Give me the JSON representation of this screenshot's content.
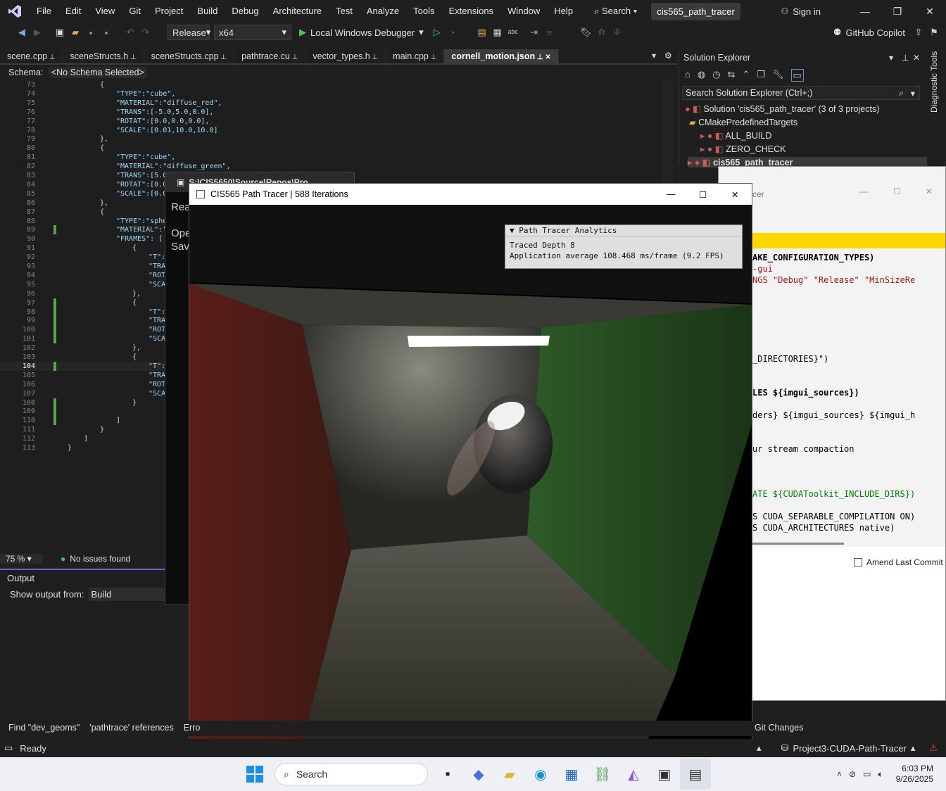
{
  "menubar": {
    "items": [
      "File",
      "Edit",
      "View",
      "Git",
      "Project",
      "Build",
      "Debug",
      "Architecture",
      "Test",
      "Analyze",
      "Tools",
      "Extensions",
      "Window",
      "Help"
    ],
    "search_label": "Search",
    "solution_name": "cis565_path_tracer",
    "signin_label": "Sign in"
  },
  "toolbar": {
    "config": "Release",
    "platform": "x64",
    "run_label": "Local Windows Debugger",
    "copilot_label": "GitHub Copilot"
  },
  "editor": {
    "tabs": [
      "scene.cpp",
      "sceneStructs.h",
      "sceneStructs.cpp",
      "pathtrace.cu",
      "vector_types.h",
      "main.cpp",
      "cornell_motion.json"
    ],
    "active_tab": "cornell_motion.json",
    "schema_label": "Schema:",
    "schema_value": "<No Schema Selected>",
    "zoom": "75 %",
    "issues": "No issues found",
    "lines": [
      {
        "n": "73",
        "indent": 0,
        "text": "{"
      },
      {
        "n": "74",
        "indent": 1,
        "text": "\"TYPE\":\"cube\","
      },
      {
        "n": "75",
        "indent": 1,
        "text": "\"MATERIAL\":\"diffuse_red\","
      },
      {
        "n": "76",
        "indent": 1,
        "text": "\"TRANS\":[-5.0,5.0,0.0],"
      },
      {
        "n": "77",
        "indent": 1,
        "text": "\"ROTAT\":[0.0,0.0,0.0],"
      },
      {
        "n": "78",
        "indent": 1,
        "text": "\"SCALE\":[0.01,10.0,10.0]"
      },
      {
        "n": "79",
        "indent": 0,
        "text": "},"
      },
      {
        "n": "80",
        "indent": 0,
        "text": "{"
      },
      {
        "n": "81",
        "indent": 1,
        "text": "\"TYPE\":\"cube\","
      },
      {
        "n": "82",
        "indent": 1,
        "text": "\"MATERIAL\":\"diffuse_green\","
      },
      {
        "n": "83",
        "indent": 1,
        "text": "\"TRANS\":[5.0"
      },
      {
        "n": "84",
        "indent": 1,
        "text": "\"ROTAT\":[0.0"
      },
      {
        "n": "85",
        "indent": 1,
        "text": "\"SCALE\":[0.0"
      },
      {
        "n": "86",
        "indent": 0,
        "text": "},"
      },
      {
        "n": "87",
        "indent": 0,
        "text": "{"
      },
      {
        "n": "88",
        "indent": 1,
        "text": "\"TYPE\":\"sphe"
      },
      {
        "n": "89",
        "indent": 1,
        "text": "\"MATERIAL\":\""
      },
      {
        "n": "90",
        "indent": 1,
        "text": "\"FRAMES\": ["
      },
      {
        "n": "91",
        "indent": 2,
        "text": "{"
      },
      {
        "n": "92",
        "indent": 3,
        "text": "\"T\":"
      },
      {
        "n": "93",
        "indent": 3,
        "text": "\"TRA"
      },
      {
        "n": "94",
        "indent": 3,
        "text": "\"ROT"
      },
      {
        "n": "95",
        "indent": 3,
        "text": "\"SCA"
      },
      {
        "n": "96",
        "indent": 2,
        "text": "},"
      },
      {
        "n": "97",
        "indent": 2,
        "text": "{"
      },
      {
        "n": "98",
        "indent": 3,
        "text": "\"T\":"
      },
      {
        "n": "99",
        "indent": 3,
        "text": "\"TRA"
      },
      {
        "n": "100",
        "indent": 3,
        "text": "\"ROT"
      },
      {
        "n": "101",
        "indent": 3,
        "text": "\"SCA"
      },
      {
        "n": "102",
        "indent": 2,
        "text": "},"
      },
      {
        "n": "103",
        "indent": 2,
        "text": "{"
      },
      {
        "n": "104",
        "indent": 3,
        "text": "\"T\":"
      },
      {
        "n": "105",
        "indent": 3,
        "text": "\"TRA"
      },
      {
        "n": "106",
        "indent": 3,
        "text": "\"ROT"
      },
      {
        "n": "107",
        "indent": 3,
        "text": "\"SCA"
      },
      {
        "n": "108",
        "indent": 2,
        "text": "}"
      },
      {
        "n": "109",
        "indent": 1,
        "text": ""
      },
      {
        "n": "110",
        "indent": 1,
        "text": "]"
      },
      {
        "n": "111",
        "indent": 0,
        "text": "}"
      },
      {
        "n": "112",
        "indent": -1,
        "text": "]"
      },
      {
        "n": "113",
        "indent": -2,
        "text": "}"
      }
    ]
  },
  "output": {
    "title": "Output",
    "show_label": "Show output from:",
    "source": "Build"
  },
  "terminal": {
    "title": "S:\\CIS5650\\Source\\Repos\\Pro",
    "lines": [
      "Rea",
      "Ope",
      "Sav"
    ]
  },
  "solution_explorer": {
    "title": "Solution Explorer",
    "search_placeholder": "Search Solution Explorer (Ctrl+;)",
    "items": [
      {
        "label": "Solution 'cis565_path_tracer' (3 of 3 projects)"
      },
      {
        "label": "CMakePredefinedTargets"
      },
      {
        "label": "ALL_BUILD"
      },
      {
        "label": "ZERO_CHECK"
      },
      {
        "label": "cis565_path_tracer"
      }
    ],
    "side_tab": "Diagnostic Tools"
  },
  "cmake_window": {
    "title_fragment": "cer",
    "lines": [
      "AKE_CONFIGURATION_TYPES)",
      "-gui",
      "NGS \"Debug\" \"Release\" \"MinSizeRe",
      "_DIRECTORIES}\")",
      "LES ${imgui_sources})",
      "ders} ${imgui_sources} ${imgui_h",
      "ur stream compaction",
      "ATE ${CUDAToolkit_INCLUDE_DIRS})",
      "S CUDA_SEPARABLE_COMPILATION ON)",
      "S CUDA_ARCHITECTURES native)"
    ],
    "amend_label": "Amend Last Commit"
  },
  "path_tracer": {
    "title": "CIS565 Path Tracer | 588 Iterations",
    "analytics_title": "Path Tracer Analytics",
    "depth_line": "Traced Depth 8",
    "fps_line": "Application average 108.468 ms/frame (9.2 FPS)"
  },
  "bottom_tabs": {
    "items": [
      "Find \"dev_geoms\"",
      "'pathtrace' references",
      "Erro"
    ],
    "git_changes": "Git Changes"
  },
  "statusbar": {
    "ready": "Ready",
    "repo": "Project3-CUDA-Path-Tracer"
  },
  "taskbar": {
    "search_label": "Search",
    "time": "6:03 PM",
    "date": "9/26/2025"
  }
}
